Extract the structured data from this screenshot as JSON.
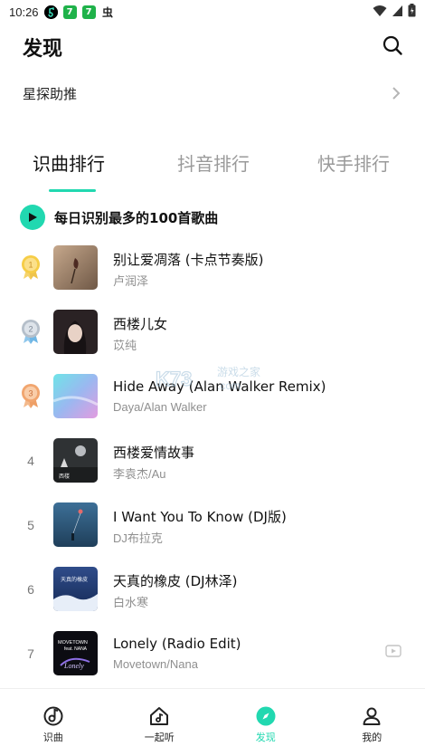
{
  "status_bar": {
    "time": "10:26",
    "app_icons": [
      "music-app-icon",
      "seven-app-icon",
      "seven-app-icon",
      "chinese-char-icon"
    ],
    "chinese_char": "虫",
    "icons_right": [
      "wifi-icon",
      "signal-icon",
      "battery-icon"
    ]
  },
  "header": {
    "title": "发现",
    "search_icon": "search-icon"
  },
  "promo": {
    "label": "星探助推"
  },
  "tabs": [
    {
      "label": "识曲排行",
      "active": true
    },
    {
      "label": "抖音排行",
      "active": false
    },
    {
      "label": "快手排行",
      "active": false
    }
  ],
  "play_all": {
    "label": "每日识别最多的100首歌曲"
  },
  "songs": [
    {
      "rank": "1",
      "medal": "gold",
      "title": "别让爱凋落 (卡点节奏版)",
      "artist": "卢润泽",
      "mv": false
    },
    {
      "rank": "2",
      "medal": "silver",
      "title": "西楼儿女",
      "artist": "苡纯",
      "mv": false
    },
    {
      "rank": "3",
      "medal": "bronze",
      "title": "Hide Away (Alan Walker Remix)",
      "artist": "Daya/Alan Walker",
      "mv": false
    },
    {
      "rank": "4",
      "medal": "",
      "title": "西楼爱情故事",
      "artist": "李袁杰/Au",
      "mv": false
    },
    {
      "rank": "5",
      "medal": "",
      "title": "I Want You To Know (DJ版)",
      "artist": "DJ布拉克",
      "mv": false
    },
    {
      "rank": "6",
      "medal": "",
      "title": "天真的橡皮 (DJ林泽)",
      "artist": "白水寒",
      "mv": false
    },
    {
      "rank": "7",
      "medal": "",
      "title": "Lonely (Radio Edit)",
      "artist": "Movetown/Nana",
      "mv": true
    }
  ],
  "watermark": {
    "brand": "K73",
    "text": "游戏之家",
    "domain": ".com"
  },
  "bottom_nav": [
    {
      "label": "识曲",
      "icon": "music-note-circle-icon",
      "active": false
    },
    {
      "label": "一起听",
      "icon": "house-music-icon",
      "active": false
    },
    {
      "label": "发现",
      "icon": "compass-icon",
      "active": true
    },
    {
      "label": "我的",
      "icon": "person-icon",
      "active": false
    }
  ],
  "colors": {
    "accent": "#21d8b0",
    "gold": "#f1c232",
    "silver": "#a9b4c2",
    "bronze": "#f0a36b"
  }
}
